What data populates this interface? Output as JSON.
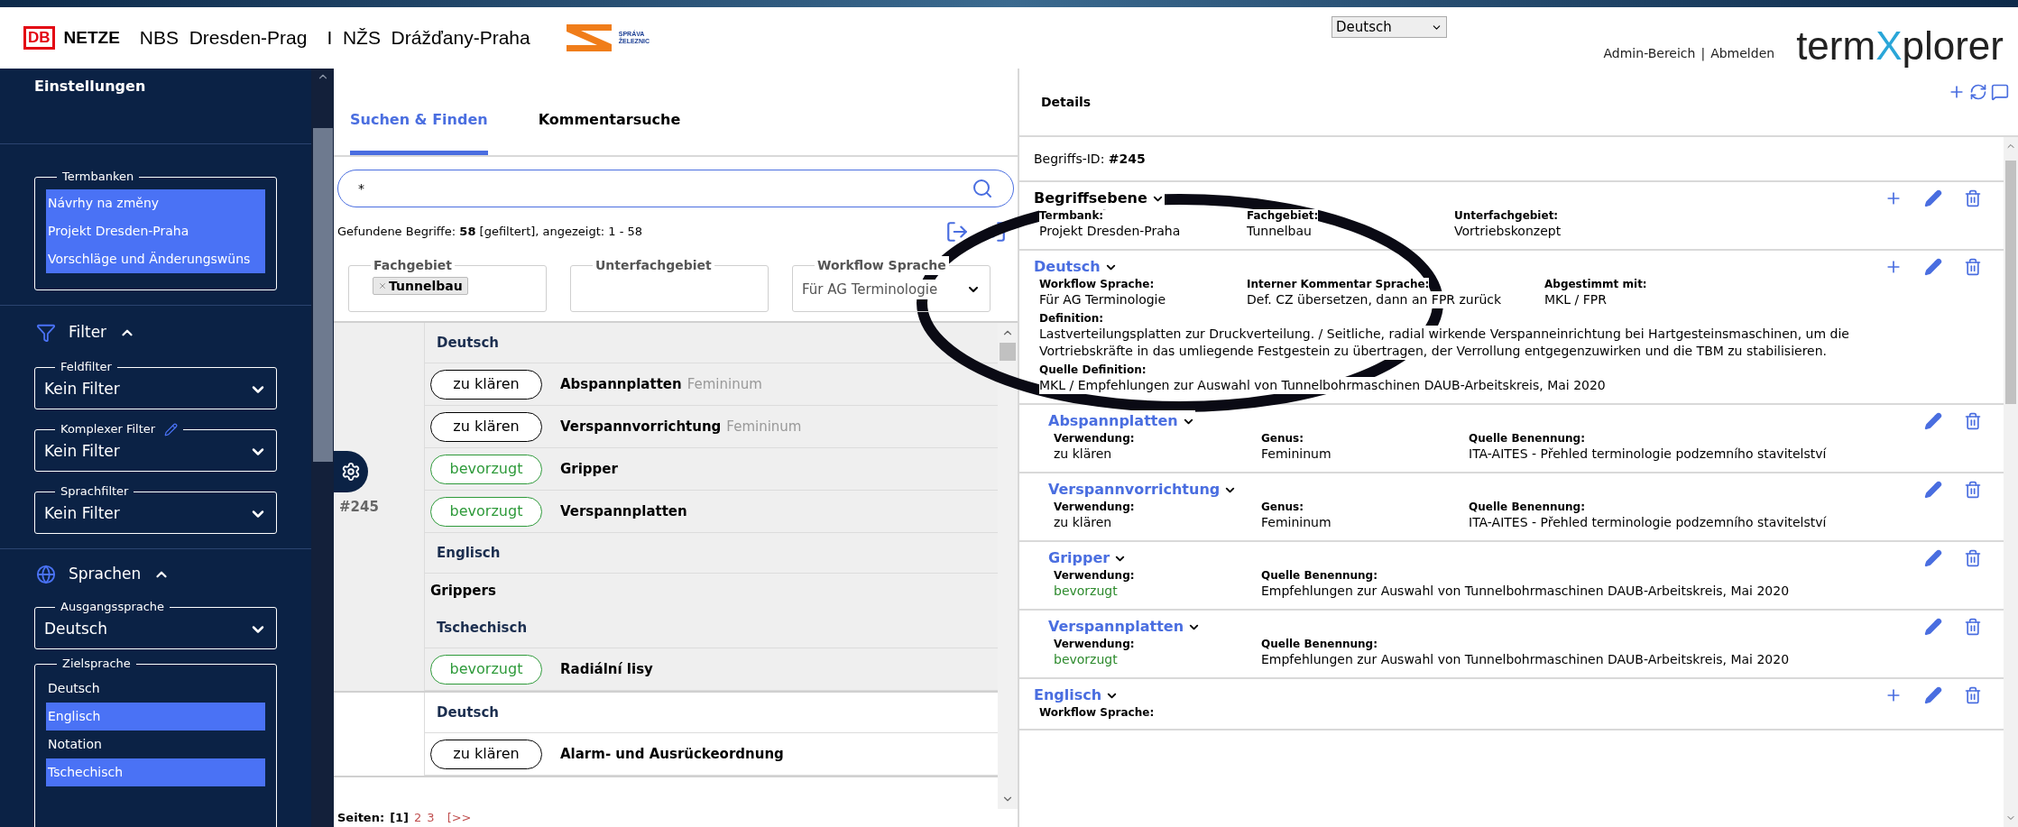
{
  "header": {
    "brand_badge": "DB",
    "brand_name": "NETZE",
    "project": "NBS  Dresden-Prag",
    "project_cz": "I  NŽS  Drážďany-Praha",
    "partner_logo": [
      "SPRÁVA",
      "ŽELEZNIC"
    ],
    "language_select": "Deutsch",
    "links": [
      "Admin-Bereich",
      "Abmelden"
    ],
    "link_separator": "|",
    "app_logo": [
      "term",
      "X",
      "plorer"
    ]
  },
  "sidebar": {
    "title": "Einstellungen",
    "termbanken": {
      "legend": "Termbanken",
      "items": [
        {
          "label": "Návrhy na změny",
          "selected": true
        },
        {
          "label": "Projekt Dresden-Praha",
          "selected": true
        },
        {
          "label": "Vorschläge und Änderungswüns",
          "selected": true
        }
      ]
    },
    "filter": {
      "title": "Filter",
      "expanded": true,
      "fields": [
        {
          "legend": "Feldfilter",
          "value": "Kein Filter",
          "editable": false
        },
        {
          "legend": "Komplexer Filter",
          "value": "Kein Filter",
          "editable": true
        },
        {
          "legend": "Sprachfilter",
          "value": "Kein Filter",
          "editable": false
        }
      ]
    },
    "sprachen": {
      "title": "Sprachen",
      "expanded": true,
      "source": {
        "legend": "Ausgangssprache",
        "value": "Deutsch"
      },
      "target": {
        "legend": "Zielsprache",
        "items": [
          {
            "label": "Deutsch",
            "selected": false
          },
          {
            "label": "Englisch",
            "selected": true
          },
          {
            "label": "Notation",
            "selected": false
          },
          {
            "label": "Tschechisch",
            "selected": true
          }
        ]
      }
    }
  },
  "search_panel": {
    "tabs": [
      {
        "label": "Suchen & Finden",
        "selected": true
      },
      {
        "label": "Kommentarsuche",
        "selected": false
      }
    ],
    "search": {
      "value": "*"
    },
    "result_summary": "Gefundene Begriffe: **58** [gefiltert], angezeigt: 1 - 58",
    "filters": [
      {
        "legend": "Fachgebiet",
        "kind": "tags",
        "tags": [
          "Tunnelbau"
        ]
      },
      {
        "legend": "Unterfachgebiet",
        "kind": "tags"
      },
      {
        "legend": "Workflow Sprache",
        "kind": "select",
        "value": "Für AG Terminologie"
      }
    ],
    "concepts": [
      {
        "id": "#245",
        "selected": true,
        "lines": [
          {
            "kind": "language",
            "label": "Deutsch"
          },
          {
            "kind": "term",
            "status": "zu klären",
            "preferred": false,
            "term": "Abspannplatten",
            "genus": "Femininum"
          },
          {
            "kind": "term",
            "status": "zu klären",
            "preferred": false,
            "term": "Verspannvorrichtung",
            "genus": "Femininum"
          },
          {
            "kind": "term",
            "status": "bevorzugt",
            "preferred": true,
            "term": "Gripper"
          },
          {
            "kind": "term",
            "status": "bevorzugt",
            "preferred": true,
            "term": "Verspannplatten"
          },
          {
            "kind": "language",
            "label": "Englisch"
          },
          {
            "kind": "plain",
            "label": "Grippers"
          },
          {
            "kind": "language",
            "label": "Tschechisch"
          },
          {
            "kind": "term",
            "status": "bevorzugt",
            "preferred": true,
            "term": "Radiální lisy"
          }
        ]
      },
      {
        "selected": false,
        "lines": [
          {
            "kind": "language",
            "label": "Deutsch"
          },
          {
            "kind": "term",
            "status": "zu klären",
            "preferred": false,
            "term": "Alarm- und Ausrückeordnung"
          }
        ]
      }
    ],
    "pagination": {
      "label": "Seiten:",
      "pages": [
        {
          "label": "[1]",
          "selected": true
        },
        {
          "label": "2",
          "selected": false
        },
        {
          "label": "3",
          "selected": false
        }
      ],
      "next": "[>>"
    }
  },
  "details": {
    "title": "Details",
    "id_label": "Begriffs-ID:",
    "id_value": "#245",
    "sections": [
      {
        "title": "Begriffsebene",
        "kind": "concept",
        "addable": true,
        "rows": [
          [
            {
              "label": "Termbank:",
              "value": "Projekt Dresden-Praha"
            },
            {
              "label": "Fachgebiet:",
              "value": "Tunnelbau"
            },
            {
              "label": "Unterfachgebiet:",
              "value": "Vortriebskonzept"
            }
          ]
        ]
      },
      {
        "title": "Deutsch",
        "kind": "language",
        "addable": true,
        "rows": [
          [
            {
              "label": "Workflow Sprache:",
              "value": "Für AG Terminologie"
            },
            {
              "label": "Interner Kommentar Sprache:",
              "value": "Def. CZ übersetzen, dann an FPR zurück"
            },
            {
              "label": "Abgestimmt mit:",
              "value": "MKL / FPR"
            }
          ],
          [
            {
              "label": "Definition:",
              "value": "Lastverteilungsplatten zur Druckverteilung. / Seitliche, radial wirkende Verspanneinrichtung bei Hartgesteinsmaschinen, um die Vortriebskräfte in das umliegende Festgestein zu übertragen, der Verrollung entgegenzuwirken und die TBM zu stabilisieren."
            }
          ],
          [
            {
              "label": "Quelle Definition:",
              "value": "MKL / Empfehlungen zur Auswahl von Tunnelbohrmaschinen DAUB-Arbeitskreis, Mai 2020"
            }
          ]
        ]
      },
      {
        "title": "Abspannplatten",
        "kind": "term",
        "addable": false,
        "rows": [
          [
            {
              "label": "Verwendung:",
              "value": "zu klären",
              "preferred": false
            },
            {
              "label": "Genus:",
              "value": "Femininum"
            },
            {
              "label": "Quelle Benennung:",
              "value": "ITA-AITES - Přehled terminologie podzemního stavitelství"
            }
          ]
        ]
      },
      {
        "title": "Verspannvorrichtung",
        "kind": "term",
        "addable": false,
        "rows": [
          [
            {
              "label": "Verwendung:",
              "value": "zu klären",
              "preferred": false
            },
            {
              "label": "Genus:",
              "value": "Femininum"
            },
            {
              "label": "Quelle Benennung:",
              "value": "ITA-AITES - Přehled terminologie podzemního stavitelství"
            }
          ]
        ]
      },
      {
        "title": "Gripper",
        "kind": "term",
        "addable": false,
        "rows": [
          [
            {
              "label": "Verwendung:",
              "value": "bevorzugt",
              "preferred": true
            },
            {
              "label": "Quelle Benennung:",
              "value": "Empfehlungen zur Auswahl von Tunnelbohrmaschinen DAUB-Arbeitskreis, Mai 2020"
            }
          ]
        ]
      },
      {
        "title": "Verspannplatten",
        "kind": "term",
        "addable": false,
        "rows": [
          [
            {
              "label": "Verwendung:",
              "value": "bevorzugt",
              "preferred": true
            },
            {
              "label": "Quelle Benennung:",
              "value": "Empfehlungen zur Auswahl von Tunnelbohrmaschinen DAUB-Arbeitskreis, Mai 2020"
            }
          ]
        ]
      },
      {
        "title": "Englisch",
        "kind": "language",
        "addable": true,
        "rows": [
          [
            {
              "label": "Workflow Sprache:"
            }
          ]
        ]
      }
    ]
  },
  "annotation": {
    "kind": "ellipse"
  }
}
